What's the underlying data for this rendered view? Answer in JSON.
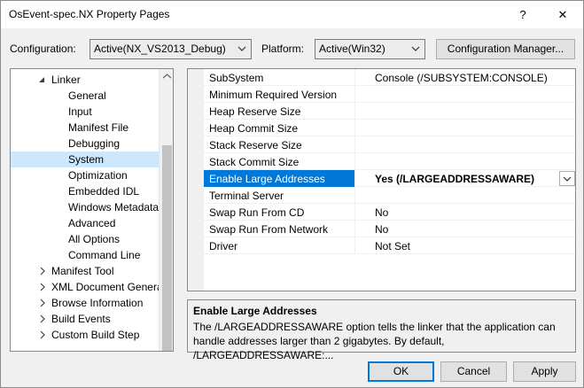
{
  "window": {
    "title": "OsEvent-spec.NX Property Pages",
    "help_label": "?",
    "close_label": "✕"
  },
  "config_bar": {
    "configuration_label": "Configuration:",
    "configuration_value": "Active(NX_VS2013_Debug)",
    "platform_label": "Platform:",
    "platform_value": "Active(Win32)",
    "manager_button": "Configuration Manager..."
  },
  "tree": {
    "items": [
      {
        "label": "Linker",
        "arrow": "expanded"
      },
      {
        "label": "General"
      },
      {
        "label": "Input"
      },
      {
        "label": "Manifest File"
      },
      {
        "label": "Debugging"
      },
      {
        "label": "System",
        "selected": true
      },
      {
        "label": "Optimization"
      },
      {
        "label": "Embedded IDL"
      },
      {
        "label": "Windows Metadata"
      },
      {
        "label": "Advanced"
      },
      {
        "label": "All Options"
      },
      {
        "label": "Command Line"
      },
      {
        "label": "Manifest Tool",
        "arrow": "collapsed"
      },
      {
        "label": "XML Document Genera",
        "arrow": "collapsed"
      },
      {
        "label": "Browse Information",
        "arrow": "collapsed"
      },
      {
        "label": "Build Events",
        "arrow": "collapsed"
      },
      {
        "label": "Custom Build Step",
        "arrow": "collapsed"
      }
    ]
  },
  "properties": [
    {
      "name": "SubSystem",
      "value": "Console (/SUBSYSTEM:CONSOLE)"
    },
    {
      "name": "Minimum Required Version",
      "value": ""
    },
    {
      "name": "Heap Reserve Size",
      "value": ""
    },
    {
      "name": "Heap Commit Size",
      "value": ""
    },
    {
      "name": "Stack Reserve Size",
      "value": ""
    },
    {
      "name": "Stack Commit Size",
      "value": ""
    },
    {
      "name": "Enable Large Addresses",
      "value": "Yes (/LARGEADDRESSAWARE)",
      "selected": true
    },
    {
      "name": "Terminal Server",
      "value": ""
    },
    {
      "name": "Swap Run From CD",
      "value": "No"
    },
    {
      "name": "Swap Run From Network",
      "value": "No"
    },
    {
      "name": "Driver",
      "value": "Not Set"
    }
  ],
  "description": {
    "title": "Enable Large Addresses",
    "text": "The /LARGEADDRESSAWARE option tells the linker that the application can handle addresses larger than 2 gigabytes. By default, /LARGEADDRESSAWARE:..."
  },
  "footer": {
    "ok": "OK",
    "cancel": "Cancel",
    "apply": "Apply"
  },
  "colors": {
    "selection_blue": "#0078d7",
    "tree_selection": "#cce8ff"
  }
}
